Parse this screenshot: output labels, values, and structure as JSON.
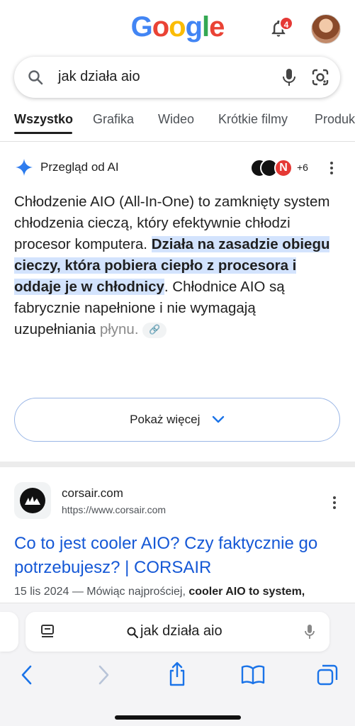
{
  "header": {
    "logo_letters": [
      {
        "ch": "G",
        "color": "#4285F4"
      },
      {
        "ch": "o",
        "color": "#EA4335"
      },
      {
        "ch": "o",
        "color": "#FBBC05"
      },
      {
        "ch": "g",
        "color": "#4285F4"
      },
      {
        "ch": "l",
        "color": "#34A853"
      },
      {
        "ch": "e",
        "color": "#EA4335"
      }
    ],
    "notification_count": "4"
  },
  "search": {
    "query": "jak działa aio"
  },
  "tabs": [
    {
      "label": "Wszystko",
      "active": true
    },
    {
      "label": "Grafika",
      "active": false
    },
    {
      "label": "Wideo",
      "active": false
    },
    {
      "label": "Krótkie filmy",
      "active": false
    },
    {
      "label": "Produkty",
      "active": false
    }
  ],
  "ai_overview": {
    "title": "Przegląd od AI",
    "sources_more": "+6",
    "source_badge_letter": "N",
    "text_part1": "Chłodzenie AIO (All-In-One) to zamknięty system chłodzenia cieczą, który efektywnie chłodzi procesor komputera.",
    "text_highlight": "Działa na zasadzie obiegu cieczy, która pobiera ciepło z procesora i oddaje je w chłodnicy",
    "text_part2": ". Chłodnice AIO są fabrycznie napełnione i nie wymagają uzupełniania",
    "text_part3": "płynu.",
    "show_more_label": "Pokaż więcej"
  },
  "result": {
    "site": "corsair.com",
    "url": "https://www.corsair.com",
    "title": "Co to jest cooler AIO? Czy faktycznie go potrzebujesz? | CORSAIR",
    "date": "15 lis 2024",
    "snippet_prefix": " — Mówiąc najprościej, ",
    "snippet_bold": "cooler AIO to system,"
  },
  "browser": {
    "address_text": "jak działa aio"
  },
  "colors": {
    "accent_blue": "#1558d6",
    "highlight": "#d3e3fd",
    "badge_red": "#e53935"
  }
}
